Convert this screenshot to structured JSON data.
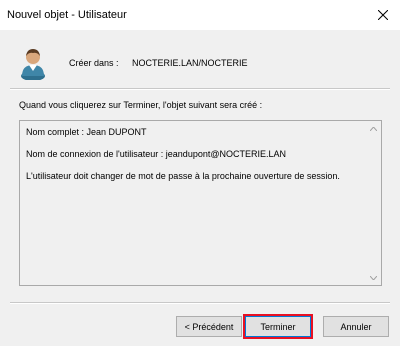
{
  "window": {
    "title": "Nouvel objet - Utilisateur"
  },
  "header": {
    "create_label": "Créer dans :",
    "create_value": "NOCTERIE.LAN/NOCTERIE",
    "icon": "user-icon"
  },
  "intro": "Quand vous cliquerez sur Terminer, l'objet suivant sera créé :",
  "summary": {
    "lines": [
      "Nom complet : Jean DUPONT",
      "Nom de connexion de l'utilisateur : jeandupont@NOCTERIE.LAN",
      "L'utilisateur doit changer de mot de passe à la prochaine ouverture de session."
    ]
  },
  "buttons": {
    "previous": "< Précédent",
    "finish": "Terminer",
    "cancel": "Annuler"
  },
  "colors": {
    "dialog_bg": "#f0f0f0",
    "highlight": "#e81123",
    "focus": "#0078d7"
  }
}
